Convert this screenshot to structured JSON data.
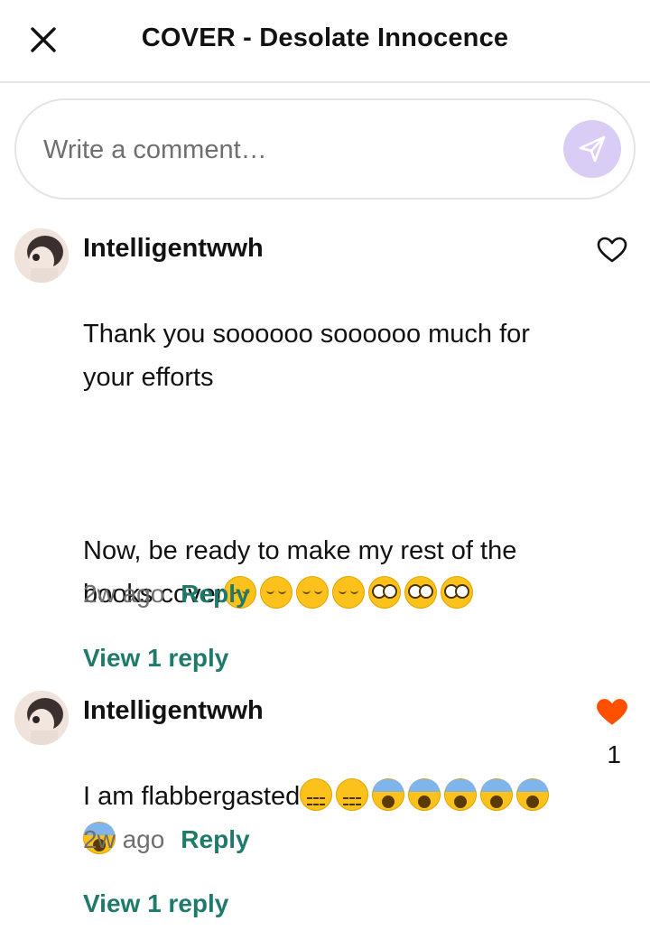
{
  "header": {
    "title": "COVER - Desolate Innocence",
    "close_icon": "close-icon"
  },
  "composer": {
    "placeholder": "Write a comment…",
    "send_icon": "send-icon",
    "send_color": "#d9cdf6"
  },
  "comments": [
    {
      "username": "Intelligentwwh",
      "text_part1": "Thank you soooooo soooooo much for\nyour efforts\n\n\n\nNow, be ready to make my rest of the\nbooks cover",
      "emojis": [
        "relieved",
        "relieved",
        "relieved",
        "relieved",
        "nerd",
        "nerd",
        "nerd"
      ],
      "time": "2w ago",
      "reply_label": "Reply",
      "view_replies_label": "View 1 reply",
      "liked": false,
      "like_count": ""
    },
    {
      "username": "Intelligentwwh",
      "text_part1": "I am flabbergasted",
      "emojis": [
        "zipper",
        "zipper",
        "scream",
        "scream",
        "scream",
        "scream",
        "scream",
        "scream"
      ],
      "time": "2w ago",
      "reply_label": "Reply",
      "view_replies_label": "View 1 reply",
      "liked": true,
      "like_count": "1"
    }
  ],
  "colors": {
    "accent": "#1f7a6b",
    "like": "#ff5000",
    "muted": "#6f6f6f"
  }
}
